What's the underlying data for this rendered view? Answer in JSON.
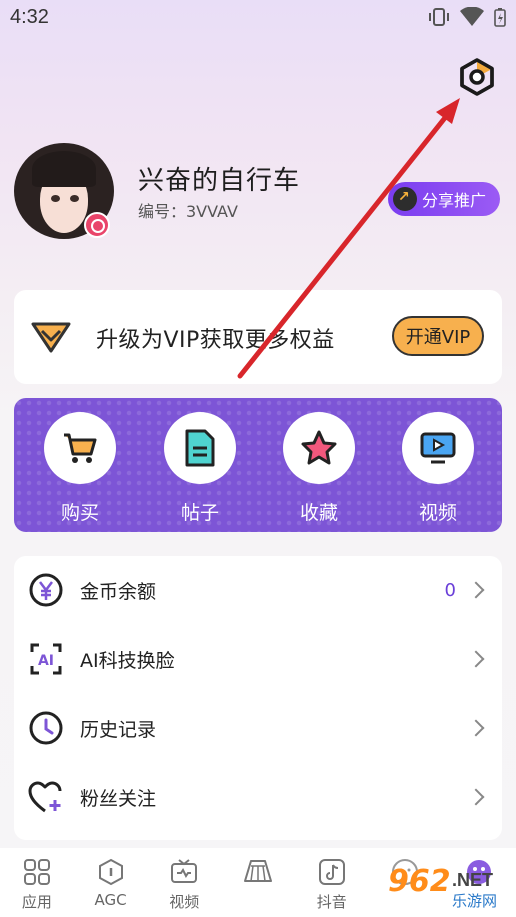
{
  "status_bar": {
    "time": "4:32",
    "icons": [
      "vibrate-icon",
      "wifi-icon",
      "battery-icon"
    ]
  },
  "header": {
    "settings_icon": "hexagon-settings-icon"
  },
  "profile": {
    "username": "兴奋的自行车",
    "user_id": "编号：3VVAV",
    "share_label": "分享推广"
  },
  "vip": {
    "text": "升级为VIP获取更多权益",
    "button_label": "开通VIP"
  },
  "features": [
    {
      "label": "购买",
      "icon": "cart-icon"
    },
    {
      "label": "帖子",
      "icon": "document-icon"
    },
    {
      "label": "收藏",
      "icon": "star-icon"
    },
    {
      "label": "视频",
      "icon": "tv-play-icon"
    }
  ],
  "menu": [
    {
      "label": "金币余额",
      "value": "0",
      "icon": "coin-yen-icon"
    },
    {
      "label": "AI科技换脸",
      "value": "",
      "icon": "ai-face-icon"
    },
    {
      "label": "历史记录",
      "value": "",
      "icon": "clock-icon"
    },
    {
      "label": "粉丝关注",
      "value": "",
      "icon": "heart-plus-icon"
    }
  ],
  "tabbar": [
    {
      "label": "应用",
      "icon": "apps-grid-icon"
    },
    {
      "label": "AGC",
      "icon": "agc-icon"
    },
    {
      "label": "视频",
      "icon": "tv-icon"
    },
    {
      "label": "",
      "icon": "skirt-icon"
    },
    {
      "label": "抖音",
      "icon": "tiktok-icon"
    },
    {
      "label": "",
      "icon": "face-icon"
    },
    {
      "label": "",
      "icon": "profile-icon"
    }
  ],
  "watermark": {
    "logo": "962",
    "net": ".NET",
    "cn": "乐游网"
  },
  "colors": {
    "accent_purple": "#7d55d6",
    "vip_gold": "#f7b04e",
    "annotation_red": "#d8262b"
  }
}
